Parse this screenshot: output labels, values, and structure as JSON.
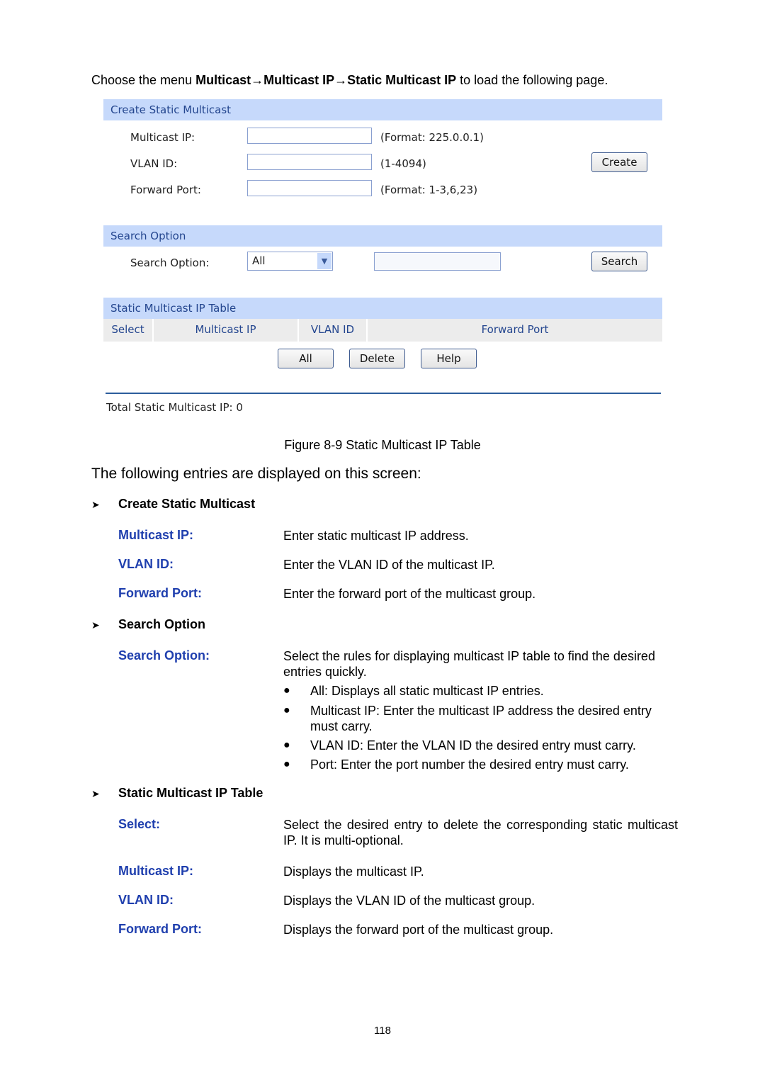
{
  "intro": {
    "prefix": "Choose the menu ",
    "path": "Multicast→Multicast IP→Static Multicast IP",
    "suffix": " to load the following page."
  },
  "ui": {
    "create": {
      "title": "Create Static Multicast",
      "fields": [
        {
          "label": "Multicast IP:",
          "value": "",
          "hint": "(Format: 225.0.0.1)"
        },
        {
          "label": "VLAN ID:",
          "value": "",
          "hint": "(1-4094)"
        },
        {
          "label": "Forward Port:",
          "value": "",
          "hint": "(Format: 1-3,6,23)"
        }
      ],
      "button": "Create"
    },
    "search": {
      "title": "Search Option",
      "label": "Search Option:",
      "selected": "All",
      "value": "",
      "button": "Search"
    },
    "table": {
      "title": "Static Multicast IP Table",
      "columns": [
        "Select",
        "Multicast IP",
        "VLAN ID",
        "Forward Port"
      ],
      "rows": [],
      "buttons": [
        "All",
        "Delete",
        "Help"
      ],
      "total": "Total Static Multicast IP: 0"
    }
  },
  "caption": "Figure 8-9 Static Multicast IP Table",
  "lead": "The following entries are displayed on this screen:",
  "sections": [
    {
      "title": "Create Static Multicast",
      "entries": [
        {
          "term": "Multicast IP:",
          "desc": "Enter static multicast IP address."
        },
        {
          "term": "VLAN ID:",
          "desc": "Enter the VLAN ID of the multicast IP."
        },
        {
          "term": "Forward Port:",
          "desc": "Enter the forward port of the multicast group."
        }
      ]
    },
    {
      "title": "Search Option",
      "entries": [
        {
          "term": "Search Option:",
          "desc": "Select the rules for displaying multicast IP table to find the desired entries quickly.",
          "bullets": [
            "All: Displays all static multicast IP entries.",
            "Multicast IP: Enter the multicast IP address the desired entry must carry.",
            "VLAN ID: Enter the VLAN ID the desired entry must carry.",
            "Port: Enter the port number the desired entry must carry."
          ]
        }
      ]
    },
    {
      "title": "Static Multicast IP Table",
      "entries": [
        {
          "term": "Select:",
          "desc": "Select the desired entry to delete the corresponding static multicast IP. It is multi-optional."
        },
        {
          "term": "Multicast IP:",
          "desc": "Displays the multicast IP."
        },
        {
          "term": "VLAN ID:",
          "desc": "Displays the VLAN ID of the multicast group."
        },
        {
          "term": "Forward Port:",
          "desc": "Displays the forward port of the multicast group."
        }
      ]
    }
  ],
  "page_number": "118",
  "colors": {
    "bar": "#c6d9fb",
    "bar_text": "#24468f",
    "term": "#1f3fae",
    "rule": "#2c5d9c"
  }
}
